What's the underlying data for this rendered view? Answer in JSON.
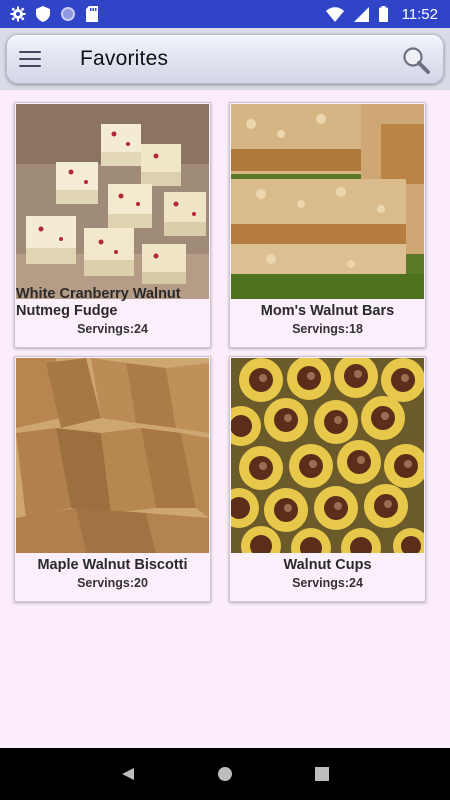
{
  "status_bar": {
    "time": "11:52",
    "left_icons": [
      "gear-icon",
      "shield-icon",
      "circle-icon",
      "sd-card-icon"
    ],
    "right_icons": [
      "wifi-icon",
      "signal-icon",
      "battery-icon"
    ]
  },
  "app_bar": {
    "title": "Favorites",
    "menu_icon": "hamburger-menu-icon",
    "search_icon": "search-icon"
  },
  "recipes": [
    {
      "name": "White Cranberry Walnut Nutmeg Fudge",
      "servings": "Servings:24",
      "image": "fudge-photo"
    },
    {
      "name": "Mom's Walnut Bars",
      "servings": "Servings:18",
      "image": "walnut-bars-photo"
    },
    {
      "name": "Maple Walnut Biscotti",
      "servings": "Servings:20",
      "image": "biscotti-photo"
    },
    {
      "name": "Walnut Cups",
      "servings": "Servings:24",
      "image": "walnut-cups-photo"
    }
  ],
  "nav_bar": {
    "icons": [
      "back-icon",
      "home-icon",
      "recents-icon"
    ]
  },
  "colors": {
    "status_bar": "#3044c8",
    "background": "#fbeefa",
    "nav_bar": "#000000"
  }
}
